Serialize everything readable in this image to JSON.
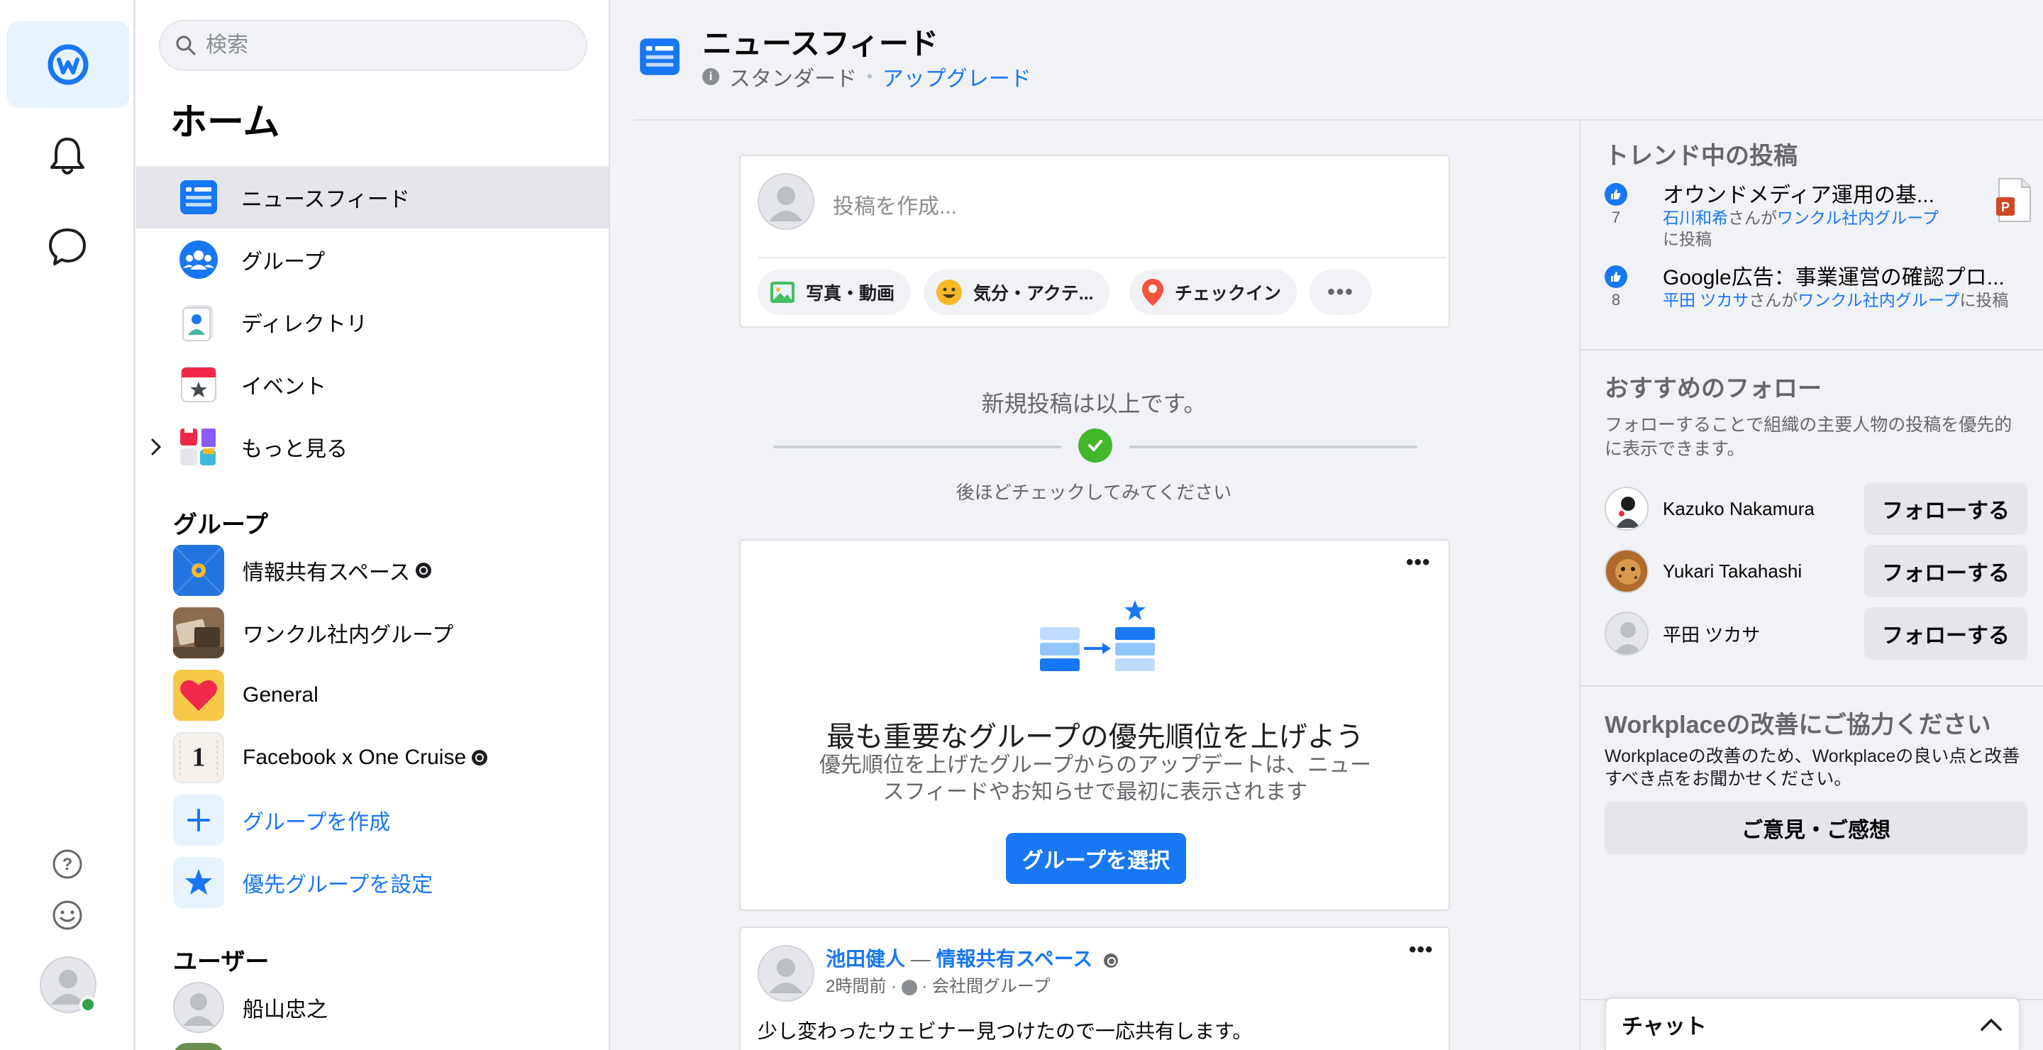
{
  "app": {
    "brand_color": "#1877f2",
    "active_bg": "#e4e6eb"
  },
  "search": {
    "placeholder": "検索"
  },
  "nav": {
    "home_title": "ホーム",
    "items": [
      {
        "label": "ニュースフィード",
        "icon": "newsfeed-icon",
        "active": true
      },
      {
        "label": "グループ",
        "icon": "groups-icon"
      },
      {
        "label": "ディレクトリ",
        "icon": "directory-icon"
      },
      {
        "label": "イベント",
        "icon": "events-icon"
      },
      {
        "label": "もっと見る",
        "icon": "more-apps-icon"
      }
    ],
    "groups_title": "グループ",
    "groups": [
      {
        "label": "情報共有スペース",
        "public": true
      },
      {
        "label": "ワンクル社内グループ"
      },
      {
        "label": "General"
      },
      {
        "label": "Facebook x One Cruise",
        "public": true
      }
    ],
    "create_group": "グループを作成",
    "set_priority": "優先グループを設定",
    "users_title": "ユーザー",
    "users": [
      {
        "label": "船山忠之"
      }
    ]
  },
  "header": {
    "title": "ニュースフィード",
    "plan": "スタンダード",
    "upgrade": "アップグレード"
  },
  "composer": {
    "placeholder": "投稿を作成...",
    "photo": "写真・動画",
    "feeling": "気分・アクテ...",
    "checkin": "チェックイン"
  },
  "caught_up": {
    "title": "新規投稿は以上です。",
    "subtitle": "後ほどチェックしてみてください"
  },
  "priority_card": {
    "title": "最も重要なグループの優先順位を上げよう",
    "description": "優先順位を上げたグループからのアップデートは、ニュースフィードやお知らせで最初に表示されます",
    "button": "グループを選択"
  },
  "post": {
    "author": "池田健人",
    "separator": "—",
    "group": "情報共有スペース",
    "time": "2時間前",
    "audience": "会社間グループ",
    "body": "少し変わったウェビナー見つけたので一応共有します。"
  },
  "trending": {
    "title": "トレンド中の投稿",
    "items": [
      {
        "likes": "7",
        "title": "オウンドメディア運用の基...",
        "user": "石川和希",
        "mid": "さんが",
        "group": "ワンクル社内グループ",
        "tail": "に投稿"
      },
      {
        "likes": "8",
        "title": "Google広告：事業運営の確認プロ...",
        "user": "平田 ツカサ",
        "mid": "さんが",
        "group": "ワンクル社内グループ",
        "tail": "に投稿"
      }
    ]
  },
  "suggested": {
    "title": "おすすめのフォロー",
    "description": "フォローすることで組織の主要人物の投稿を優先的に表示できます。",
    "follow_label": "フォローする",
    "people": [
      {
        "name": "Kazuko Nakamura"
      },
      {
        "name": "Yukari Takahashi"
      },
      {
        "name": "平田 ツカサ"
      }
    ]
  },
  "feedback": {
    "title": "Workplaceの改善にご協力ください",
    "description": "Workplaceの改善のため、Workplaceの良い点と改善すべき点をお聞かせください。",
    "button": "ご意見・ご感想"
  },
  "chat": {
    "label": "チャット"
  }
}
